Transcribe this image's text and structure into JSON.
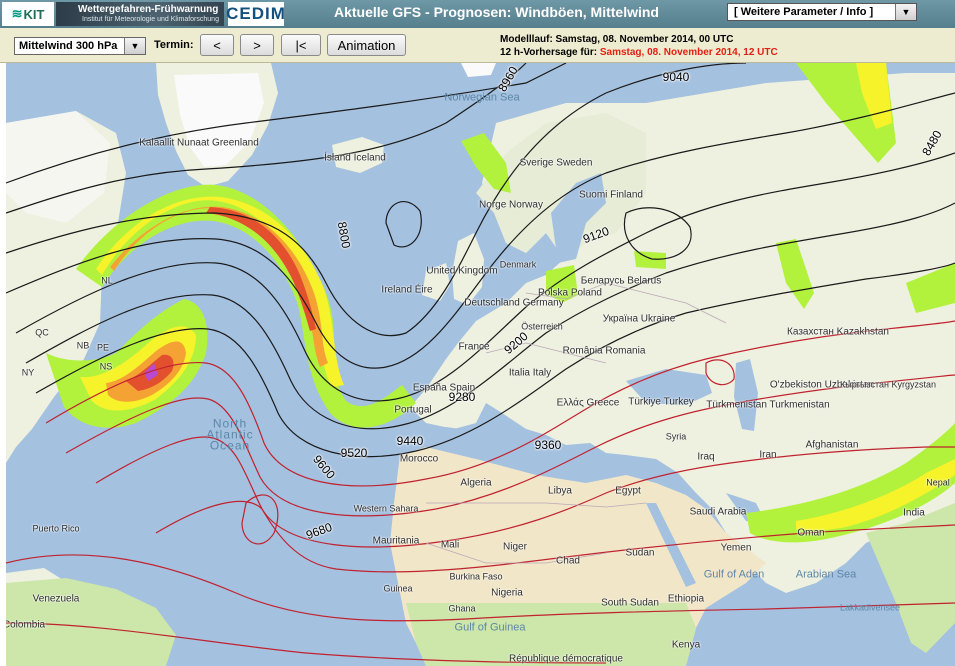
{
  "header": {
    "kit_logo_text": "KIT",
    "banner_title": "Wettergefahren-Frühwarnung",
    "banner_subtitle": "Institut für Meteorologie und Klimaforschung",
    "cedim_logo_text": "CEDIM",
    "title": "Aktuelle GFS - Prognosen: Windböen, Mittelwind",
    "param_select_value": "[ Weitere Parameter / Info ]",
    "dropdown_icon": "triangle-down-icon"
  },
  "toolbar": {
    "level_select_value": "Mittelwind 300 hPa",
    "termin_label": "Termin:",
    "prev_label": "<",
    "next_label": ">",
    "first_label": "|<",
    "animation_label": "Animation",
    "model_run_text": "Modelllauf: Samstag, 08. November 2014, 00 UTC",
    "forecast_prefix": "12 h-Vorhersage für:",
    "forecast_time": "Samstag, 08. November 2014, 12 UTC"
  },
  "map": {
    "colors": {
      "water": "#a4c1e0",
      "land": "#eef0e0",
      "desert": "#f1e6c8",
      "green": "#cde6a9",
      "ice": "#fafafa",
      "wind_low": "#b2f23c",
      "wind_mid": "#f6f32b",
      "wind_high": "#f5a234",
      "wind_max": "#e2502e",
      "wind_peak": "#b84ad0",
      "contour_black": "#1a1a1a",
      "contour_red": "#c0222e"
    },
    "contour_labels": [
      "8960",
      "9040",
      "8480",
      "8800",
      "9120",
      "9200",
      "9280",
      "9360",
      "9440",
      "9520",
      "9600",
      "9680"
    ],
    "places": [
      "Kalaallit Nunaat Greenland",
      "Ísland Iceland",
      "Norwegian Sea",
      "Sverige Sweden",
      "Suomi Finland",
      "Norge Norway",
      "United Kingdom",
      "Ireland Éire",
      "Denmark",
      "Deutschland Germany",
      "Polska Poland",
      "Беларусь Belarus",
      "France",
      "Österreich",
      "Україна Ukraine",
      "Italia Italy",
      "România Romania",
      "España Spain",
      "Portugal",
      "Ελλάς Greece",
      "Türkiye Turkey",
      "Казахстан Kazakhstan",
      "O'zbekiston Uzbekistan",
      "Кыргызстан Kyrgyzstan",
      "Türkmenistan Turkmenistan",
      "Afghanistan",
      "Iraq",
      "Iran",
      "Syria",
      "North Atlantic Ocean",
      "Morocco",
      "Algeria",
      "Libya",
      "Egypt",
      "Saudi Arabia",
      "Western Sahara",
      "Mauritania",
      "Mali",
      "Niger",
      "Chad",
      "Sudan",
      "South Sudan",
      "Ethiopia",
      "Nigeria",
      "Burkina Faso",
      "Guinea",
      "Ghana",
      "Oman",
      "Yemen",
      "Gulf of Aden",
      "Arabian Sea",
      "India",
      "Nepal",
      "Puerto Rico",
      "Venezuela",
      "Colombia",
      "Gulf of Guinea",
      "Kenya",
      "République démocratique",
      "Lakkadivensee",
      "NL",
      "NB",
      "PE",
      "NS",
      "QC",
      "NY"
    ]
  }
}
